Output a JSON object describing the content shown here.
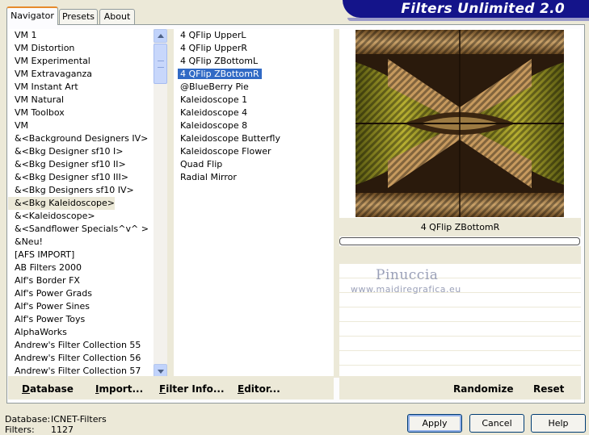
{
  "tabs": [
    {
      "label": "Navigator",
      "active": true
    },
    {
      "label": "Presets",
      "active": false
    },
    {
      "label": "About",
      "active": false
    }
  ],
  "banner": {
    "title": "Filters Unlimited 2.0"
  },
  "categories": [
    "VM 1",
    "VM Distortion",
    "VM Experimental",
    "VM Extravaganza",
    "VM Instant Art",
    "VM Natural",
    "VM Toolbox",
    "VM",
    "&<Background Designers IV>",
    "&<Bkg Designer sf10 I>",
    "&<Bkg Designer sf10 II>",
    "&<Bkg Designer sf10 III>",
    "&<Bkg Designers sf10 IV>",
    "&<Bkg Kaleidoscope>",
    "&<Kaleidoscope>",
    "&<Sandflower Specials^v^ >",
    "&Neu!",
    "[AFS IMPORT]",
    "AB Filters 2000",
    "Alf's Border FX",
    "Alf's Power Grads",
    "Alf's Power Sines",
    "Alf's Power Toys",
    "AlphaWorks",
    "Andrew's Filter Collection 55",
    "Andrew's Filter Collection 56",
    "Andrew's Filter Collection 57"
  ],
  "selected_category": "&<Bkg Kaleidoscope>",
  "filters": [
    "4 QFlip UpperL",
    "4 QFlip UpperR",
    "4 QFlip ZBottomL",
    "4 QFlip ZBottomR",
    "@BlueBerry Pie",
    "Kaleidoscope 1",
    "Kaleidoscope 4",
    "Kaleidoscope 8",
    "Kaleidoscope Butterfly",
    "Kaleidoscope Flower",
    "Quad Flip",
    "Radial Mirror"
  ],
  "selected_filter": "4 QFlip ZBottomR",
  "left_buttons": {
    "database": "Database",
    "import": "Import...",
    "filter_info": "Filter Info...",
    "editor": "Editor..."
  },
  "preview": {
    "caption": "4 QFlip ZBottomR",
    "progress": 0,
    "watermark_name": "Pinuccia",
    "watermark_url": "www.maidiregrafica.eu"
  },
  "right_buttons": {
    "randomize": "Randomize",
    "reset": "Reset"
  },
  "status": {
    "database_label": "Database:",
    "database_value": "ICNET-Filters",
    "filters_label": "Filters:",
    "filters_value": "1127"
  },
  "dialog_buttons": {
    "apply": "Apply",
    "cancel": "Cancel",
    "help": "Help"
  },
  "colors": {
    "selection": "#316ac5",
    "banner": "#14148a",
    "tab_accent": "#e68b2c"
  }
}
